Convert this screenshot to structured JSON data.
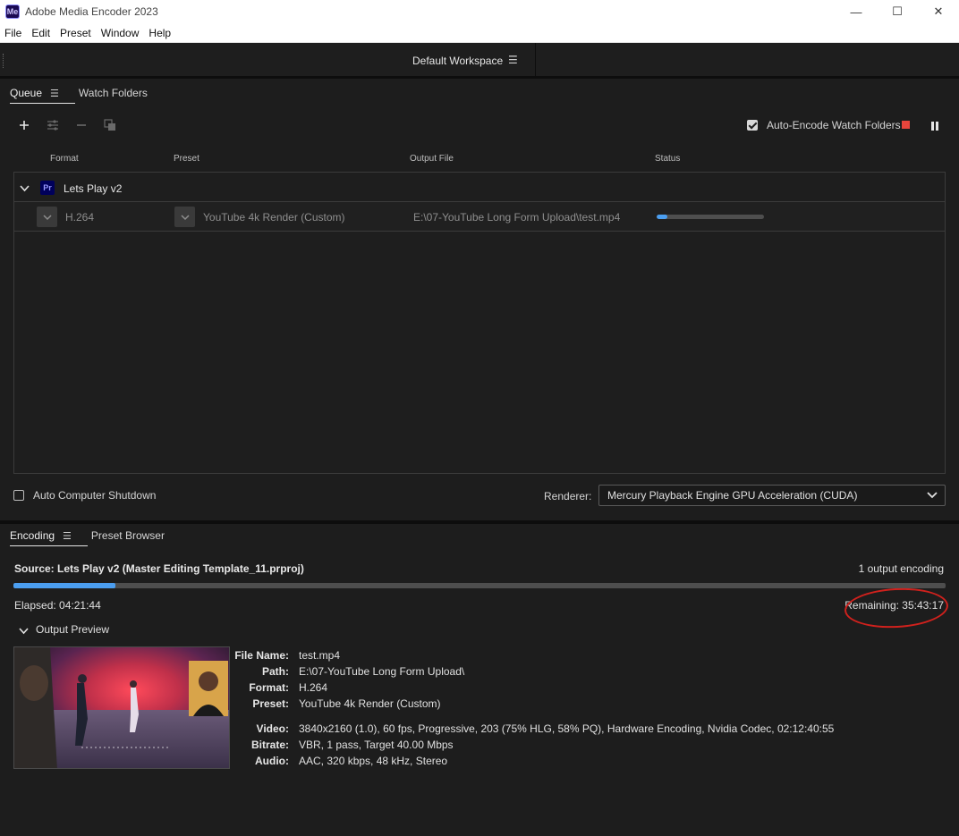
{
  "titlebar": {
    "app_icon": "Me",
    "title": "Adobe Media Encoder 2023",
    "minimize": "—",
    "maximize": "☐",
    "close": "✕"
  },
  "menu": [
    "File",
    "Edit",
    "Preset",
    "Window",
    "Help"
  ],
  "workspace": {
    "label": "Default Workspace",
    "menu_icon": "hamburger-icon"
  },
  "queue_panel": {
    "tabs": [
      {
        "label": "Queue",
        "active": true
      },
      {
        "label": "Watch Folders",
        "active": false
      }
    ],
    "toolbar": {
      "add_icon": "plus-icon",
      "settings_icon": "sliders-icon",
      "remove_icon": "minus-icon",
      "duplicate_icon": "duplicate-icon"
    },
    "auto_encode": {
      "label": "Auto-Encode Watch Folders",
      "checked": true
    },
    "columns": {
      "format": "Format",
      "preset": "Preset",
      "output": "Output File",
      "status": "Status"
    },
    "group": {
      "badge": "Pr",
      "name": "Lets Play v2"
    },
    "item": {
      "format": "H.264",
      "preset": "YouTube 4k Render (Custom)",
      "output": "E:\\07-YouTube Long Form Upload\\test.mp4",
      "progress": 0.1
    },
    "auto_shutdown": {
      "label": "Auto Computer Shutdown",
      "checked": false
    },
    "renderer": {
      "label": "Renderer:",
      "value": "Mercury Playback Engine GPU Acceleration (CUDA)"
    }
  },
  "encoding_panel": {
    "tabs": [
      {
        "label": "Encoding",
        "active": true
      },
      {
        "label": "Preset Browser",
        "active": false
      }
    ],
    "source": "Source: Lets Play v2 (Master Editing Template_11.prproj)",
    "outputs_count": "1 output encoding",
    "progress": 0.109,
    "elapsed": "Elapsed: 04:21:44",
    "remaining": "Remaining: 35:43:17",
    "output_preview_label": "Output Preview",
    "details": {
      "file_name_label": "File Name:",
      "file_name": "test.mp4",
      "path_label": "Path:",
      "path": "E:\\07-YouTube Long Form Upload\\",
      "format_label": "Format:",
      "format": "H.264",
      "preset_label": "Preset:",
      "preset": "YouTube 4k Render (Custom)",
      "video_label": "Video:",
      "video": "3840x2160 (1.0), 60 fps, Progressive, 203 (75% HLG, 58% PQ), Hardware Encoding, Nvidia Codec, 02:12:40:55",
      "bitrate_label": "Bitrate:",
      "bitrate": "VBR, 1 pass, Target 40.00 Mbps",
      "audio_label": "Audio:",
      "audio": "AAC, 320 kbps, 48 kHz, Stereo"
    }
  },
  "colors": {
    "accent": "#4b9ef0",
    "stop": "#e8453c",
    "annotation": "#d0211d"
  }
}
